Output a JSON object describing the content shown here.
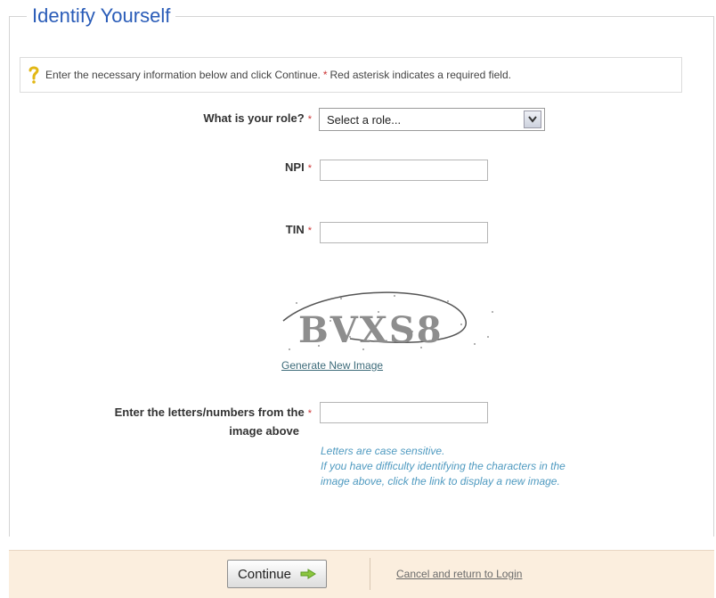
{
  "page_title": "Identify Yourself",
  "info": {
    "text_before": "Enter the necessary information below and click Continue.",
    "asterisk": "*",
    "text_after": "Red asterisk indicates a required field."
  },
  "form": {
    "role_label": "What is your role?",
    "role_selected": "Select a role...",
    "npi_label": "NPI",
    "npi_value": "",
    "tin_label": "TIN",
    "tin_value": "",
    "required_mark": "*",
    "captcha_text": "BVXS8",
    "generate_link": "Generate New Image",
    "captcha_label_line1": "Enter the letters/numbers from the",
    "captcha_label_line2": "image above",
    "captcha_value": "",
    "hint_line1": "Letters are case sensitive.",
    "hint_line2": "If you have difficulty identifying the characters in the",
    "hint_line3": "image above, click the link to display a new image."
  },
  "footer": {
    "continue_label": "Continue",
    "cancel_label": "Cancel and return to Login"
  },
  "colors": {
    "title": "#2a5cb8",
    "required": "#cc3333",
    "hint": "#4f9ac0",
    "footer_bg": "#fbeede"
  },
  "icons": [
    "question-mark-icon",
    "dropdown-arrow-icon",
    "green-arrow-icon"
  ]
}
